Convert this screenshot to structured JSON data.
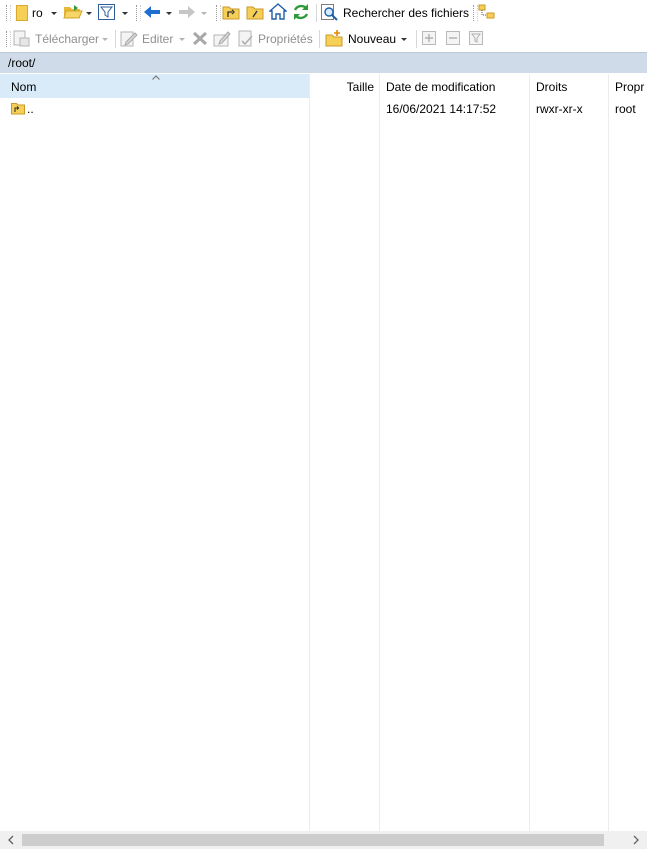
{
  "toolbar1": {
    "location_combo_value": "ro",
    "search_files_label": "Rechercher des fichiers"
  },
  "toolbar2": {
    "download_label": "Télécharger",
    "edit_label": "Editer",
    "properties_label": "Propriétés",
    "new_label": "Nouveau"
  },
  "path_bar": {
    "path": "/root/"
  },
  "file_list": {
    "columns": [
      "Nom",
      "Taille",
      "Date de modification",
      "Droits",
      "Propr"
    ],
    "rows": [
      {
        "name": "..",
        "size": "",
        "modified": "16/06/2021 14:17:52",
        "rights": "rwxr-xr-x",
        "owner": "root"
      }
    ]
  },
  "colors": {
    "path_bar_bg": "#cfdbe8",
    "header_selected_bg": "#d9ebf9",
    "folder_yellow": "#f6cf57",
    "accent_blue": "#1e6fd0",
    "refresh_green": "#2e9a3c"
  },
  "icons": [
    "folder-icon",
    "open-folder-icon",
    "filter-icon",
    "back-arrow-icon",
    "forward-arrow-icon",
    "parent-directory-icon",
    "root-directory-icon",
    "home-icon",
    "refresh-icon",
    "find-files-icon",
    "tree-icon",
    "download-icon",
    "edit-icon",
    "delete-icon",
    "rename-icon",
    "properties-icon",
    "new-icon",
    "add-icon",
    "remove-icon",
    "filter-small-icon",
    "sort-ascending-icon",
    "parent-folder-icon"
  ]
}
